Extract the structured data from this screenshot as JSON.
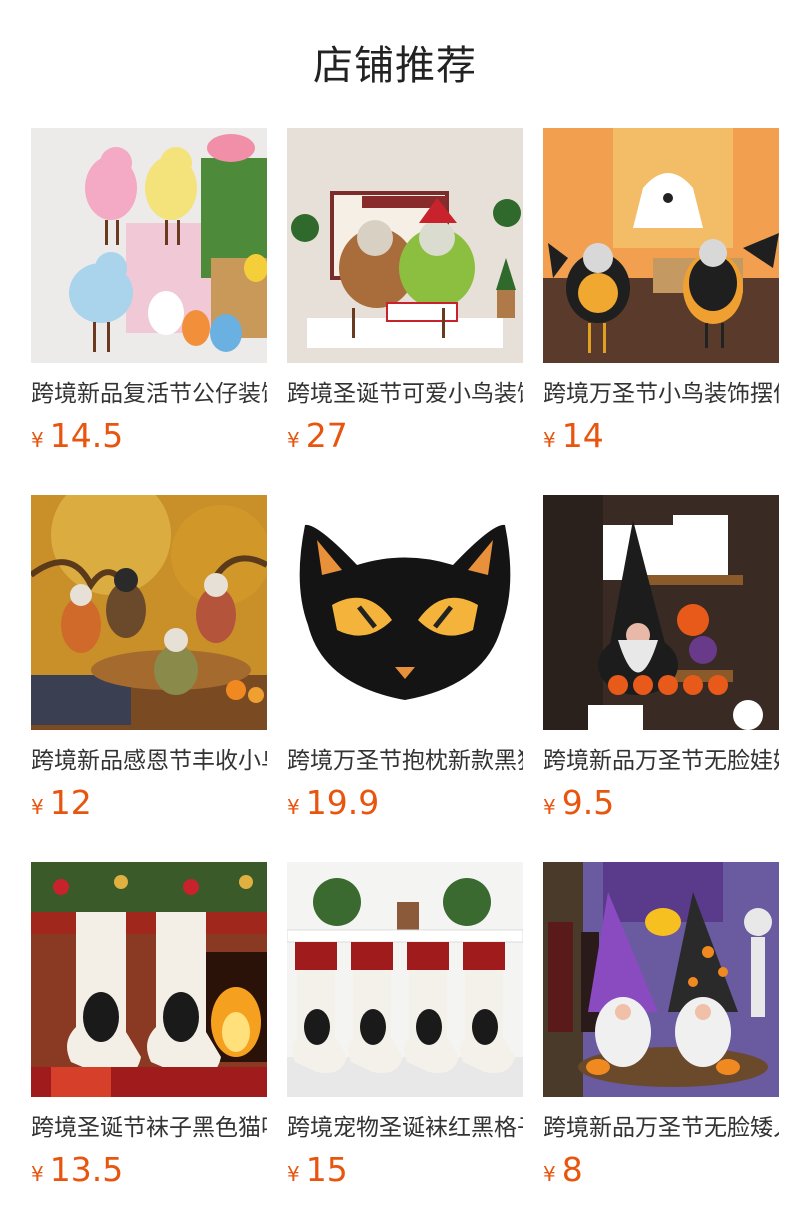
{
  "page": {
    "title": "店铺推荐"
  },
  "currency_symbol": "¥",
  "products": [
    {
      "name": "跨境新品复活节公仔装饰",
      "price": "14.5",
      "image": "easter-birds-photo"
    },
    {
      "name": "跨境圣诞节可爱小鸟装饰",
      "price": "27",
      "image": "christmas-birds-photo"
    },
    {
      "name": "跨境万圣节小鸟装饰摆件",
      "price": "14",
      "image": "halloween-birds-photo"
    },
    {
      "name": "跨境新品感恩节丰收小鸟",
      "price": "12",
      "image": "thanksgiving-birds-photo"
    },
    {
      "name": "跨境万圣节抱枕新款黑猫",
      "price": "19.9",
      "image": "black-cat-pillow-photo"
    },
    {
      "name": "跨境新品万圣节无脸娃娃",
      "price": "9.5",
      "image": "halloween-gnome-photo"
    },
    {
      "name": "跨境圣诞节袜子黑色猫咪",
      "price": "13.5",
      "image": "christmas-stockings-photo"
    },
    {
      "name": "跨境宠物圣诞袜红黑格子",
      "price": "15",
      "image": "pet-stockings-photo"
    },
    {
      "name": "跨境新品万圣节无脸矮人",
      "price": "8",
      "image": "halloween-gnomes-photo"
    }
  ]
}
